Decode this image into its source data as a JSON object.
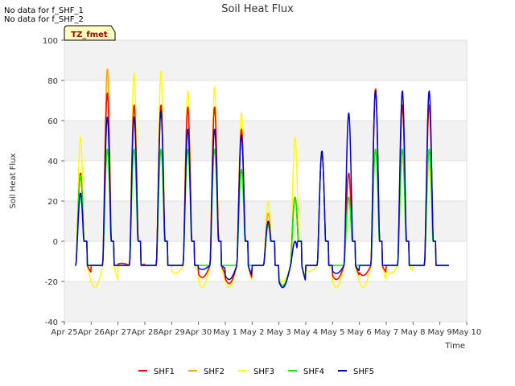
{
  "notes": [
    "No data for f_SHF_1",
    "No data for f_SHF_2"
  ],
  "chart_data": {
    "type": "line",
    "title": "Soil Heat Flux",
    "xlabel": "Time",
    "ylabel": "Soil Heat Flux",
    "tag": "TZ_fmet",
    "ylim": [
      -40,
      100
    ],
    "yticks": [
      -40,
      -20,
      0,
      20,
      40,
      60,
      80,
      100
    ],
    "xlim": [
      0,
      15
    ],
    "xticks": [
      0,
      1,
      2,
      3,
      4,
      5,
      6,
      7,
      8,
      9,
      10,
      11,
      12,
      13,
      14,
      15
    ],
    "xtick_labels": [
      "Apr 25",
      "Apr 26",
      "Apr 27",
      "Apr 28",
      "Apr 29",
      "Apr 30",
      "May 1",
      "May 2",
      "May 3",
      "May 4",
      "May 5",
      "May 6",
      "May 7",
      "May 8",
      "May 9",
      "May 10"
    ],
    "legend_position": "bottom",
    "grid": "horizontal bands",
    "colors": {
      "SHF1": "#ff0000",
      "SHF2": "#ffa500",
      "SHF3": "#ffff00",
      "SHF4": "#00ee00",
      "SHF5": "#0000cc",
      "band": "#f2f2f2",
      "tag_bg": "#ffffc0",
      "tag_text": "#990000"
    },
    "daily_peaks": {
      "SHF1": [
        34,
        74,
        68,
        68,
        67,
        67,
        56,
        9,
        22,
        45,
        34,
        76,
        68,
        68
      ],
      "SHF2": [
        34,
        86,
        68,
        68,
        67,
        67,
        56,
        14,
        22,
        45,
        34,
        76,
        68,
        68
      ],
      "SHF3": [
        52,
        83,
        84,
        85,
        75,
        77,
        64,
        20,
        52,
        45,
        22,
        76,
        42,
        38
      ],
      "SHF4": [
        33,
        46,
        46,
        46,
        46,
        46,
        36,
        8,
        22,
        45,
        22,
        46,
        46,
        46
      ],
      "SHF5": [
        24,
        62,
        62,
        65,
        56,
        56,
        53,
        10,
        0,
        45,
        64,
        75,
        75,
        75
      ]
    },
    "daily_troughs": {
      "SHF1": [
        -17,
        -12,
        -11,
        -12,
        -12,
        -18,
        -21,
        -12,
        -23,
        -12,
        -19,
        -17,
        -12,
        -12
      ],
      "SHF2": [
        -17,
        -12,
        -11,
        -12,
        -12,
        -18,
        -21,
        -12,
        -23,
        -12,
        -19,
        -17,
        -12,
        -12
      ],
      "SHF3": [
        -23,
        -23,
        -12,
        -12,
        -16,
        -23,
        -23,
        -12,
        -20,
        -15,
        -23,
        -23,
        -16,
        -12
      ],
      "SHF4": [
        -12,
        -12,
        -12,
        -12,
        -12,
        -12,
        -12,
        -12,
        -22,
        -12,
        -12,
        -12,
        -12,
        -12
      ],
      "SHF5": [
        -12,
        -12,
        -12,
        -12,
        -12,
        -14,
        -19,
        -12,
        -23,
        -12,
        -16,
        -12,
        -12,
        -12
      ]
    },
    "series": [
      {
        "name": "SHF1"
      },
      {
        "name": "SHF2"
      },
      {
        "name": "SHF3"
      },
      {
        "name": "SHF4"
      },
      {
        "name": "SHF5"
      }
    ]
  }
}
